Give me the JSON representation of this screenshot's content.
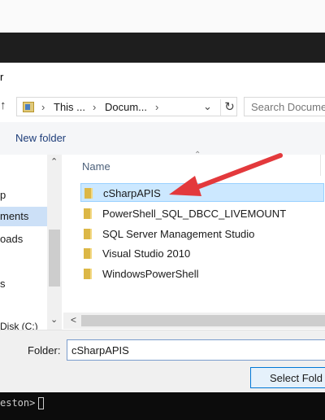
{
  "window": {
    "title_fragment": "r"
  },
  "address_bar": {
    "crumbs": [
      "This ...",
      "Docum..."
    ],
    "search_placeholder": "Search Docume"
  },
  "toolbar": {
    "new_folder_label": "New folder"
  },
  "nav_pane": {
    "items": [
      {
        "label": "p",
        "selected": false
      },
      {
        "label": "ments",
        "selected": true
      },
      {
        "label": "oads",
        "selected": false
      },
      {
        "label": "s",
        "selected": false
      }
    ],
    "bottom_item": "Disk (C:)"
  },
  "file_list": {
    "column_header": "Name",
    "rows": [
      {
        "name": "cSharpAPIS",
        "selected": true
      },
      {
        "name": "PowerShell_SQL_DBCC_LIVEMOUNT",
        "selected": false
      },
      {
        "name": "SQL Server Management Studio",
        "selected": false
      },
      {
        "name": "Visual Studio 2010",
        "selected": false
      },
      {
        "name": "WindowsPowerShell",
        "selected": false
      }
    ]
  },
  "folder_field": {
    "label": "Folder:",
    "value": "cSharpAPIS"
  },
  "buttons": {
    "select_folder": "Select Fold"
  },
  "terminal": {
    "prompt": "eston>"
  },
  "colors": {
    "selection": "#cce8ff",
    "folder_icon": "#dcb746",
    "annotation_arrow": "#e3393c",
    "link_text": "#1f3e7a"
  }
}
